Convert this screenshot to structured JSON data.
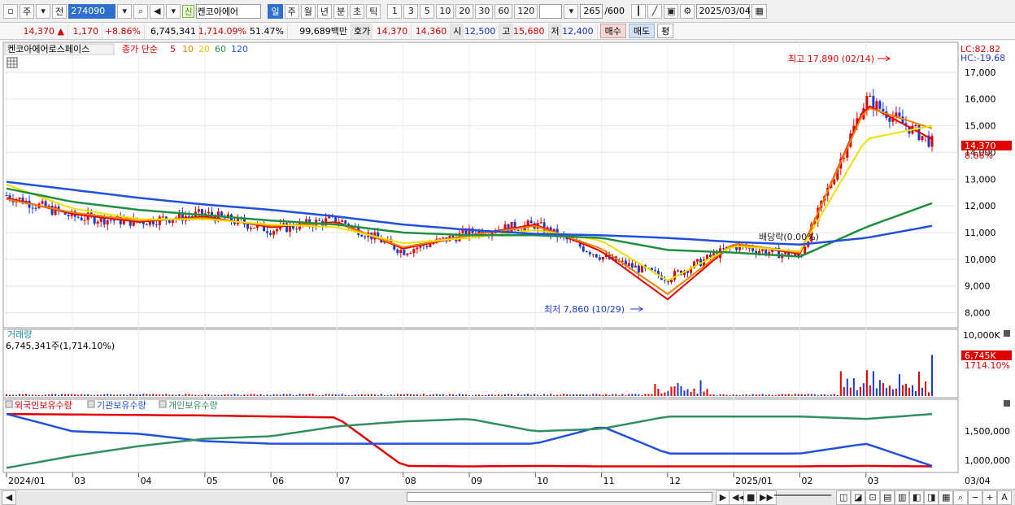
{
  "toolbar": {
    "period_prefix": "주",
    "prev_label": "전",
    "code": "274090",
    "name_badge": "신",
    "name": "켄코아에어",
    "periods": [
      "일",
      "주",
      "월",
      "년",
      "분",
      "초",
      "틱"
    ],
    "active_period": "일",
    "intervals": [
      "1",
      "3",
      "5",
      "10",
      "20",
      "30",
      "60",
      "120"
    ],
    "count": "265",
    "count_total": "/600",
    "date": "2025/03/04"
  },
  "quote": {
    "price": "14,370",
    "change_arrow": "▲",
    "change": "1,170",
    "change_pct": "+8.86%",
    "volume": "6,745,341",
    "volume_pct": "1,714.09%",
    "ratio": "51.47%",
    "amount": "99,689백만",
    "ask_label": "호가",
    "ask": "14,370",
    "bid": "14,360",
    "open_label": "시",
    "open": "12,500",
    "high_label": "고",
    "high": "15,680",
    "low_label": "저",
    "low": "12,400",
    "buy_label": "매수",
    "sell_label": "매도",
    "eval_label": "평"
  },
  "legend": {
    "name": "켄코아에어로스페이스",
    "ma_title": "종가 단순",
    "ma_periods": [
      "5",
      "10",
      "20",
      "60",
      "120"
    ]
  },
  "colors": {
    "up": "#e00000",
    "down": "#1a3ad0",
    "ma5": "#e00000",
    "ma10": "#f08000",
    "ma20": "#f0e000",
    "ma60": "#209040",
    "ma120": "#2050e0",
    "foreign": "#e00000",
    "institution": "#2050e0",
    "individual": "#309060"
  },
  "price_panel": {
    "y_ticks": [
      "17,000",
      "16,000",
      "15,000",
      "14,000",
      "13,000",
      "12,000",
      "11,000",
      "10,000",
      "9,000",
      "8,000"
    ],
    "lc_label": "LC:82.82",
    "hc_label": "HC:-19.68",
    "current_price": "14,370",
    "current_pct": "8.86%",
    "high_annotation": "최고 17,890 (02/14)",
    "low_annotation": "최저 7,860 (10/29)",
    "dividend_annotation": "배당락(0.00%)"
  },
  "volume_panel": {
    "title": "거래량",
    "value": "6,745,341주(1,714.10%)",
    "max_tick": "10,000K",
    "current": "6,745K",
    "current_pct": "1714.10%"
  },
  "holding_panel": {
    "legend": [
      "외국인보유수량",
      "기관보유수량",
      "개인보유수량"
    ],
    "y_ticks": [
      "1,500,000",
      "1,000,000"
    ]
  },
  "x_axis": {
    "labels": [
      "2024/01",
      "03",
      "04",
      "05",
      "06",
      "07",
      "08",
      "09",
      "10",
      "11",
      "12",
      "2025/01",
      "02",
      "03",
      "03/04"
    ]
  },
  "chart_data": {
    "type": "line",
    "title": "켄코아에어로스페이스",
    "x": [
      "2024/01",
      "02",
      "03",
      "04",
      "05",
      "06",
      "07",
      "08",
      "09",
      "10",
      "11",
      "12",
      "2025/01",
      "02",
      "03"
    ],
    "series": [
      {
        "name": "종가",
        "values": [
          12400,
          11600,
          11400,
          11700,
          11100,
          11500,
          10300,
          11000,
          11300,
          10100,
          9300,
          10500,
          10100,
          16000,
          14370
        ]
      },
      {
        "name": "5",
        "values": [
          12300,
          11700,
          11400,
          11600,
          11200,
          11400,
          10400,
          10900,
          11300,
          10300,
          8500,
          10600,
          10200,
          15800,
          14500
        ]
      },
      {
        "name": "10",
        "values": [
          12250,
          11750,
          11450,
          11550,
          11250,
          11350,
          10450,
          10900,
          11250,
          10400,
          8700,
          10600,
          10250,
          15700,
          14900
        ]
      },
      {
        "name": "20",
        "values": [
          12800,
          11900,
          11500,
          11500,
          11300,
          11200,
          10600,
          10800,
          11100,
          10700,
          9200,
          10500,
          10300,
          14500,
          15000
        ]
      },
      {
        "name": "60",
        "values": [
          12650,
          12150,
          11850,
          11650,
          11450,
          11300,
          11000,
          10900,
          10900,
          10800,
          10350,
          10250,
          10100,
          11200,
          12100
        ]
      },
      {
        "name": "120",
        "values": [
          12900,
          12600,
          12300,
          12050,
          11850,
          11600,
          11300,
          11100,
          10950,
          10900,
          10800,
          10650,
          10550,
          10800,
          11250
        ]
      }
    ],
    "volume": {
      "max_tick": 10000000,
      "last": 6745341
    },
    "ylim": [
      7500,
      18000
    ]
  }
}
